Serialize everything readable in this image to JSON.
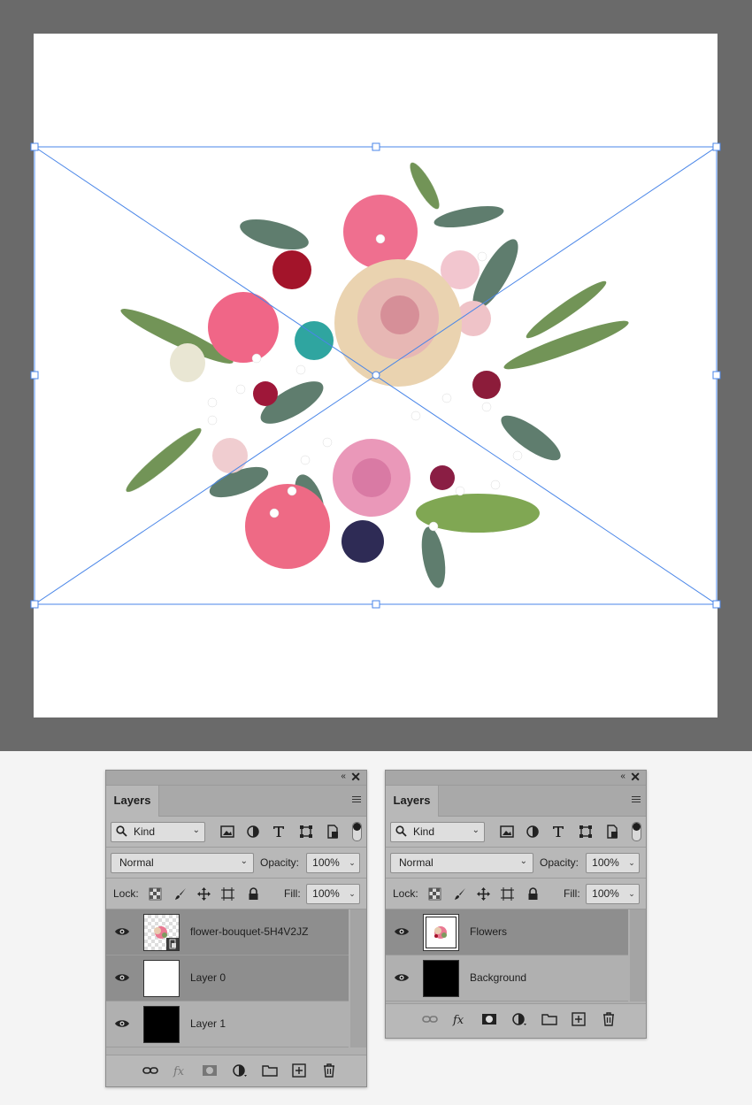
{
  "document": {
    "layer_image": "flower bouquet",
    "transform_handles": true
  },
  "panel_left": {
    "tab_label": "Layers",
    "collapse_glyph": "‹‹",
    "close_glyph": "✕",
    "filter": {
      "label": "Kind",
      "icons": [
        "pixel-filter-icon",
        "adjustment-filter-icon",
        "type-filter-icon",
        "shape-filter-icon",
        "smart-object-filter-icon"
      ]
    },
    "blend_mode": "Normal",
    "opacity_label": "Opacity:",
    "opacity_value": "100%",
    "lock_label": "Lock:",
    "fill_label": "Fill:",
    "fill_value": "100%",
    "layers": [
      {
        "name": "flower-bouquet-5H4V2JZ",
        "thumb": "flowers-smart",
        "selected": true
      },
      {
        "name": "Layer 0",
        "thumb": "white",
        "selected": true
      },
      {
        "name": "Layer 1",
        "thumb": "black",
        "selected": false
      }
    ]
  },
  "panel_right": {
    "tab_label": "Layers",
    "collapse_glyph": "‹‹",
    "close_glyph": "✕",
    "filter": {
      "label": "Kind"
    },
    "blend_mode": "Normal",
    "opacity_label": "Opacity:",
    "opacity_value": "100%",
    "lock_label": "Lock:",
    "fill_label": "Fill:",
    "fill_value": "100%",
    "layers": [
      {
        "name": "Flowers",
        "thumb": "flowers-group",
        "selected": true
      },
      {
        "name": "Background",
        "thumb": "black",
        "selected": false
      }
    ]
  },
  "colors": {
    "canvas_bg": "#6a6a6a",
    "transform_line": "#4a86e8",
    "panel_bg": "#b8b8b8",
    "selected_layer": "#8c8c8c"
  }
}
